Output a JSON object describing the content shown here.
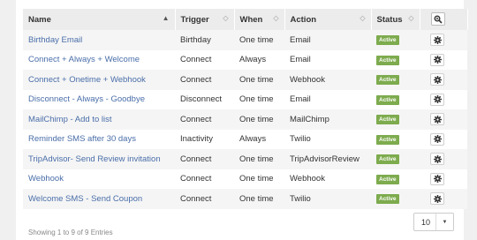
{
  "table": {
    "headers": {
      "name": "Name",
      "trigger": "Trigger",
      "when": "When",
      "action": "Action",
      "status": "Status"
    },
    "rows": [
      {
        "name": "Birthday Email",
        "trigger": "Birthday",
        "when": "One time",
        "action": "Email",
        "status": "Active"
      },
      {
        "name": "Connect + Always + Welcome",
        "trigger": "Connect",
        "when": "Always",
        "action": "Email",
        "status": "Active"
      },
      {
        "name": "Connect + Onetime + Webhook",
        "trigger": "Connect",
        "when": "One time",
        "action": "Webhook",
        "status": "Active"
      },
      {
        "name": "Disconnect - Always - Goodbye",
        "trigger": "Disconnect",
        "when": "One time",
        "action": "Email",
        "status": "Active"
      },
      {
        "name": "MailChimp - Add to list",
        "trigger": "Connect",
        "when": "One time",
        "action": "MailChimp",
        "status": "Active"
      },
      {
        "name": "Reminder SMS after 30 days",
        "trigger": "Inactivity",
        "when": "Always",
        "action": "Twilio",
        "status": "Active"
      },
      {
        "name": "TripAdvisor- Send Review invitation",
        "trigger": "Connect",
        "when": "One time",
        "action": "TripAdvisorReview",
        "status": "Active"
      },
      {
        "name": "Webhook",
        "trigger": "Connect",
        "when": "One time",
        "action": "Webhook",
        "status": "Active"
      },
      {
        "name": "Welcome SMS - Send Coupon",
        "trigger": "Connect",
        "when": "One time",
        "action": "Twilio",
        "status": "Active"
      }
    ]
  },
  "footer": {
    "entries_info": "Showing 1 to 9 of 9 Entries"
  },
  "pagination": {
    "page_size": "10"
  },
  "icons": {
    "zoom": "zoom-icon",
    "gear": "gear-icon",
    "sort": "sort-icon",
    "caret": "chevron-down-icon"
  },
  "colors": {
    "badge_active": "#7dab4e",
    "link": "#4a6ea9",
    "header_bg": "#ececec",
    "row_alt": "#f5f5f5"
  }
}
